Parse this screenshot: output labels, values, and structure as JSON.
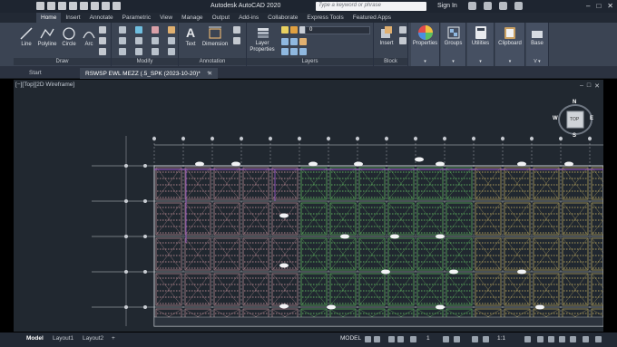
{
  "title_bar": {
    "app_title": "Autodesk AutoCAD 2020",
    "search_placeholder": "Type a keyword or phrase",
    "sign_in": "Sign In"
  },
  "ribbon_tabs": [
    "Home",
    "Insert",
    "Annotate",
    "Parametric",
    "View",
    "Manage",
    "Output",
    "Add-ins",
    "Collaborate",
    "Express Tools",
    "Featured Apps"
  ],
  "ribbon": {
    "draw_tools": [
      "Line",
      "Polyline",
      "Circle",
      "Arc"
    ],
    "draw_label": "Draw",
    "modify_label": "Modify",
    "annotation_tools": [
      "Text",
      "Dimension"
    ],
    "annotation_label": "Annotation",
    "layer_properties": "Layer Properties",
    "layers_label": "Layers",
    "layer_value": "0",
    "block_tool": "Insert",
    "block_label": "Block",
    "big_buttons": [
      "Properties",
      "Groups",
      "Utilities",
      "Clipboard",
      "Base"
    ],
    "view_label": "V"
  },
  "file_tabs": {
    "start": "Start",
    "active_file": "RSWSP EWL MEZZ (.5_SPK (2023-10-20)*",
    "add": "+"
  },
  "viewport": {
    "label": "[−][Top][2D Wireframe]",
    "viewcube_top": "TOP",
    "compass_n": "N",
    "compass_s": "S",
    "compass_e": "E",
    "compass_w": "W"
  },
  "layout_tabs": [
    "Model",
    "Layout1",
    "Layout2"
  ],
  "status_bar": {
    "mode": "MODEL",
    "scale": "1:1",
    "add_layout": "+",
    "count_value": "1"
  },
  "colors": {
    "canvas_bg": "#212830",
    "ribbon_bg": "#3b4453",
    "grid_line": "#c8ccd2",
    "zone_red": "#d9a0a8",
    "zone_green": "#6fd46a",
    "zone_yellow": "#d8c06a",
    "accent_purple": "#a45ad6"
  }
}
